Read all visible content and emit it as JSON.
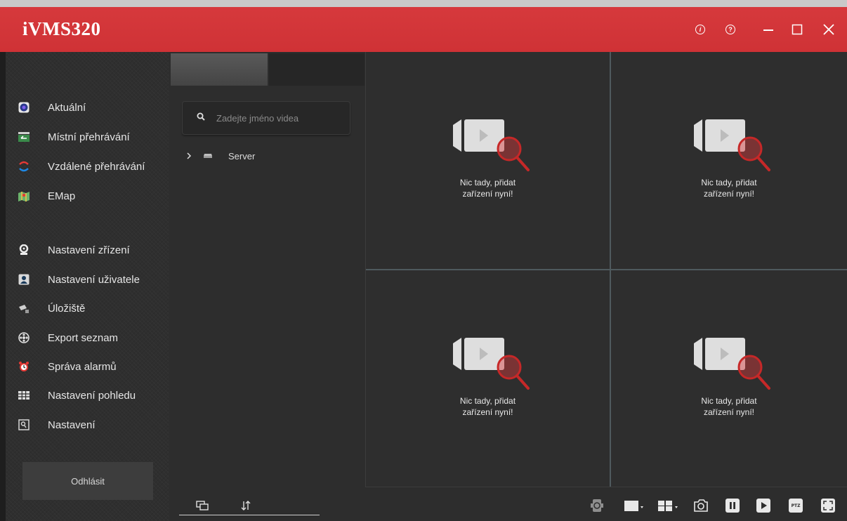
{
  "app": {
    "title": "iVMS320",
    "accent": "#d6393c"
  },
  "window_controls": [
    {
      "name": "about-icon",
      "glyph": "i"
    },
    {
      "name": "help-icon",
      "glyph": "?"
    },
    {
      "name": "minimize-icon"
    },
    {
      "name": "maximize-icon"
    },
    {
      "name": "close-icon"
    }
  ],
  "sidebar": {
    "items": [
      {
        "label": "Aktuální",
        "icon": "live-view-icon"
      },
      {
        "label": "Místní přehrávání",
        "icon": "local-playback-icon"
      },
      {
        "label": "Vzdálené přehrávání",
        "icon": "remote-playback-icon"
      },
      {
        "label": "EMap",
        "icon": "emap-icon"
      },
      {
        "label": "Nastavení zřízení",
        "icon": "device-settings-icon"
      },
      {
        "label": "Nastavení uživatele",
        "icon": "user-settings-icon"
      },
      {
        "label": "Úložiště",
        "icon": "storage-icon"
      },
      {
        "label": "Export seznam",
        "icon": "export-icon"
      },
      {
        "label": "Správa alarmů",
        "icon": "alarm-icon"
      },
      {
        "label": "Nastavení pohledu",
        "icon": "view-settings-icon"
      },
      {
        "label": "Nastavení",
        "icon": "settings-icon"
      }
    ],
    "logout_label": "Odhlásit"
  },
  "device_panel": {
    "search_placeholder": "Zadejte jméno videa",
    "tree": [
      {
        "label": "Server",
        "expanded": false
      }
    ]
  },
  "video_grid": {
    "layout": "2x2",
    "cells": [
      {
        "message": "Nic tady, přidat zařízení nyní!"
      },
      {
        "message": "Nic tady, přidat zařízení nyní!"
      },
      {
        "message": "Nic tady, přidat zařízení nyní!"
      },
      {
        "message": "Nic tady, přidat zařízení nyní!"
      }
    ]
  },
  "bottom_toolbar": {
    "ptz_label": "PTZ",
    "icons": [
      "rotate-icon",
      "single-screen-icon",
      "split-screen-icon",
      "snapshot-icon",
      "pause-icon",
      "play-icon",
      "ptz-icon",
      "fullscreen-icon"
    ]
  }
}
